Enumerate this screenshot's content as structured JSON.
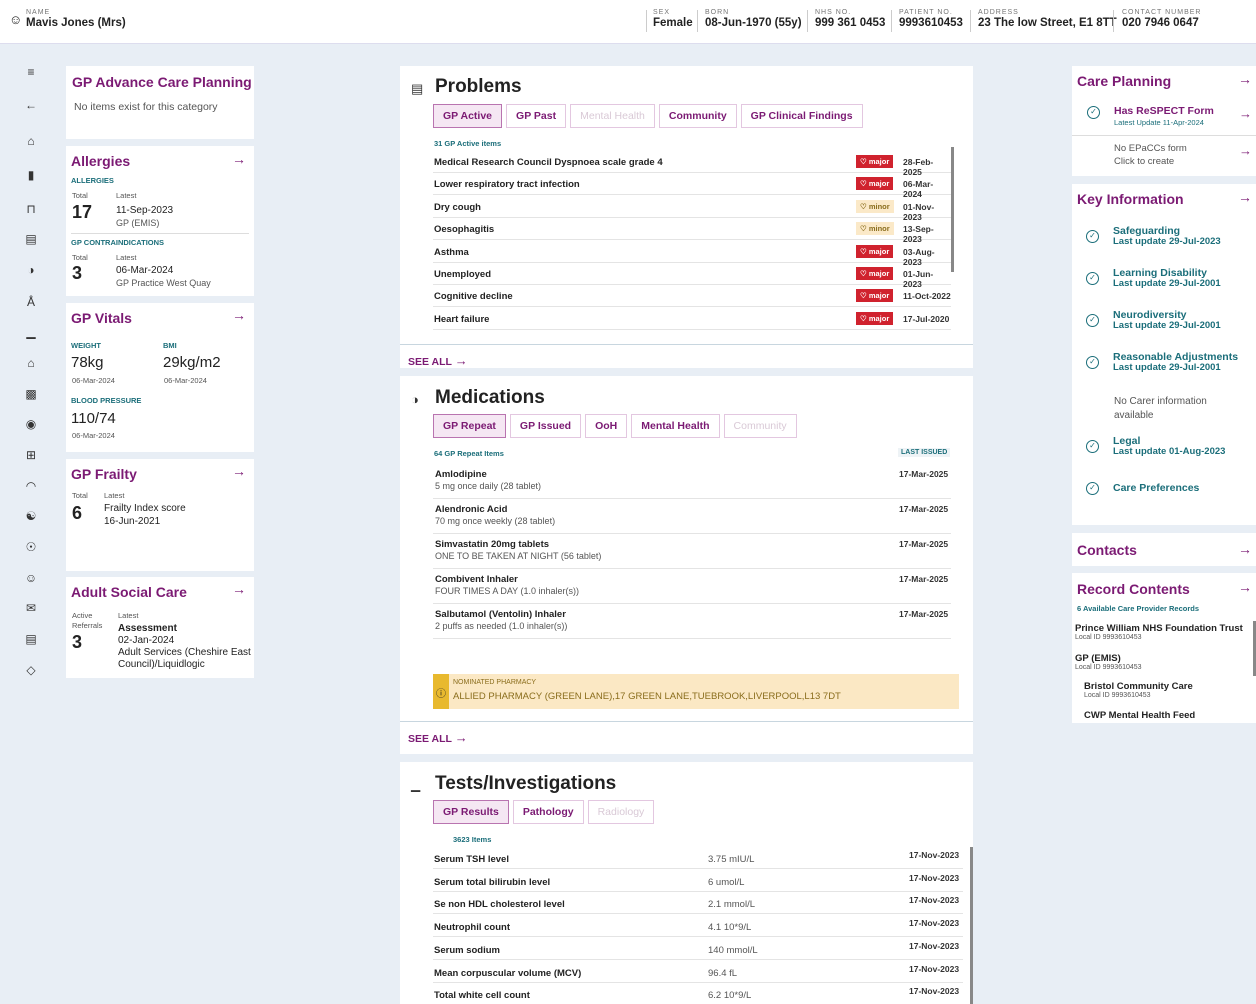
{
  "header": {
    "name_label": "NAME",
    "name": "Mavis Jones (Mrs)",
    "sex_label": "SEX",
    "sex": "Female",
    "born_label": "BORN",
    "born": "08-Jun-1970 (55y)",
    "nhs_label": "NHS NO.",
    "nhs": "999 361 0453",
    "patient_label": "PATIENT NO.",
    "patient": "9993610453",
    "address_label": "ADDRESS",
    "address": "23 The low Street, E1 8TT",
    "contact_label": "CONTACT NUMBER",
    "contact": "020 7946 0647"
  },
  "left": {
    "acp": {
      "title": "GP Advance Care Planning",
      "empty": "No items exist for this category"
    },
    "allergies": {
      "title": "Allergies",
      "section1": "ALLERGIES",
      "total_label": "Total",
      "latest_label": "Latest",
      "count1": "17",
      "date1": "11-Sep-2023",
      "src1": "GP (EMIS)",
      "section2": "GP CONTRAINDICATIONS",
      "count2": "3",
      "date2": "06-Mar-2024",
      "src2": "GP Practice West Quay"
    },
    "vitals": {
      "title": "GP Vitals",
      "weight_label": "WEIGHT",
      "weight": "78kg",
      "weight_date": "06-Mar-2024",
      "bmi_label": "BMI",
      "bmi": "29kg/m2",
      "bmi_date": "06-Mar-2024",
      "bp_label": "BLOOD PRESSURE",
      "bp": "110/74",
      "bp_date": "06-Mar-2024"
    },
    "frailty": {
      "title": "GP Frailty",
      "total_label": "Total",
      "latest_label": "Latest",
      "count": "6",
      "desc": "Frailty Index score",
      "date": "16-Jun-2021"
    },
    "asc": {
      "title": "Adult Social Care",
      "active_label": "Active",
      "referrals_label": "Referrals",
      "latest_label": "Latest",
      "count": "3",
      "type": "Assessment",
      "date": "02-Jan-2024",
      "src1": "Adult Services (Cheshire East",
      "src2": "Council)/Liquidlogic"
    }
  },
  "problems": {
    "title": "Problems",
    "tabs": [
      "GP Active",
      "GP Past",
      "Mental Health",
      "Community",
      "GP Clinical Findings"
    ],
    "count": "31 GP Active items",
    "items": [
      {
        "name": "Medical Research Council Dyspnoea scale grade 4",
        "sev": "major",
        "date": "28-Feb-2025"
      },
      {
        "name": "Lower respiratory tract infection",
        "sev": "major",
        "date": "06-Mar-2024"
      },
      {
        "name": "Dry cough",
        "sev": "minor",
        "date": "01-Nov-2023"
      },
      {
        "name": "Oesophagitis",
        "sev": "minor",
        "date": "13-Sep-2023"
      },
      {
        "name": "Asthma",
        "sev": "major",
        "date": "03-Aug-2023"
      },
      {
        "name": "Unemployed",
        "sev": "major",
        "date": "01-Jun-2023"
      },
      {
        "name": "Cognitive decline",
        "sev": "major",
        "date": "11-Oct-2022"
      },
      {
        "name": "Heart failure",
        "sev": "major",
        "date": "17-Jul-2020"
      }
    ],
    "see_all": "SEE ALL"
  },
  "medications": {
    "title": "Medications",
    "tabs": [
      "GP Repeat",
      "GP Issued",
      "OoH",
      "Mental Health",
      "Community"
    ],
    "count": "64 GP Repeat Items",
    "last_issued": "LAST ISSUED",
    "items": [
      {
        "name": "Amlodipine",
        "dose": "5 mg once daily (28 tablet)",
        "date": "17-Mar-2025"
      },
      {
        "name": "Alendronic Acid",
        "dose": "70 mg once weekly (28 tablet)",
        "date": "17-Mar-2025"
      },
      {
        "name": "Simvastatin 20mg tablets",
        "dose": "ONE TO BE TAKEN AT NIGHT (56 tablet)",
        "date": "17-Mar-2025"
      },
      {
        "name": "Combivent Inhaler",
        "dose": "FOUR TIMES A DAY (1.0 inhaler(s))",
        "date": "17-Mar-2025"
      },
      {
        "name": "Salbutamol (Ventolin) Inhaler",
        "dose": "2 puffs as needed (1.0 inhaler(s))",
        "date": "17-Mar-2025"
      }
    ],
    "pharmacy_label": "NOMINATED PHARMACY",
    "pharmacy": "ALLIED PHARMACY (GREEN LANE),17 GREEN LANE,TUEBROOK,LIVERPOOL,L13 7DT",
    "see_all": "SEE ALL"
  },
  "tests": {
    "title": "Tests/Investigations",
    "tabs": [
      "GP Results",
      "Pathology",
      "Radiology"
    ],
    "count": "3623 Items",
    "items": [
      {
        "name": "Serum TSH level",
        "value": "3.75 mIU/L",
        "date": "17-Nov-2023"
      },
      {
        "name": "Serum total bilirubin level",
        "value": "6 umol/L",
        "date": "17-Nov-2023"
      },
      {
        "name": "Se non HDL cholesterol level",
        "value": "2.1 mmol/L",
        "date": "17-Nov-2023"
      },
      {
        "name": "Neutrophil count",
        "value": "4.1 10*9/L",
        "date": "17-Nov-2023"
      },
      {
        "name": "Serum sodium",
        "value": "140 mmol/L",
        "date": "17-Nov-2023"
      },
      {
        "name": "Mean corpuscular volume (MCV)",
        "value": "96.4 fL",
        "date": "17-Nov-2023"
      },
      {
        "name": "Total white cell count",
        "value": "6.2 10*9/L",
        "date": "17-Nov-2023"
      }
    ]
  },
  "right": {
    "care": {
      "title": "Care Planning",
      "respect": "Has ReSPECT Form",
      "respect_sub": "Latest Update 11-Apr-2024",
      "epaccs": "No EPaCCs form",
      "epaccs_sub": "Click to create"
    },
    "key": {
      "title": "Key Information",
      "items": [
        {
          "t": "Safeguarding",
          "s": "Last update 29-Jul-2023"
        },
        {
          "t": "Learning Disability",
          "s": "Last update 29-Jul-2001"
        },
        {
          "t": "Neurodiversity",
          "s": "Last update 29-Jul-2001"
        },
        {
          "t": "Reasonable Adjustments",
          "s": "Last update 29-Jul-2001"
        }
      ],
      "carer1": "No Carer information",
      "carer2": "available",
      "legal": "Legal",
      "legal_sub": "Last update 01-Aug-2023",
      "prefs": "Care Preferences"
    },
    "contacts": {
      "title": "Contacts"
    },
    "record": {
      "title": "Record Contents",
      "count": "6 Available Care Provider Records",
      "items": [
        {
          "t": "Prince William NHS Foundation Trust",
          "s": "Local ID 9993610453"
        },
        {
          "t": "GP (EMIS)",
          "s": "Local ID 9993610453"
        },
        {
          "t": "Bristol Community Care",
          "s": "Local ID 9993610453"
        },
        {
          "t": "CWP Mental Health Feed",
          "s": ""
        }
      ]
    }
  }
}
